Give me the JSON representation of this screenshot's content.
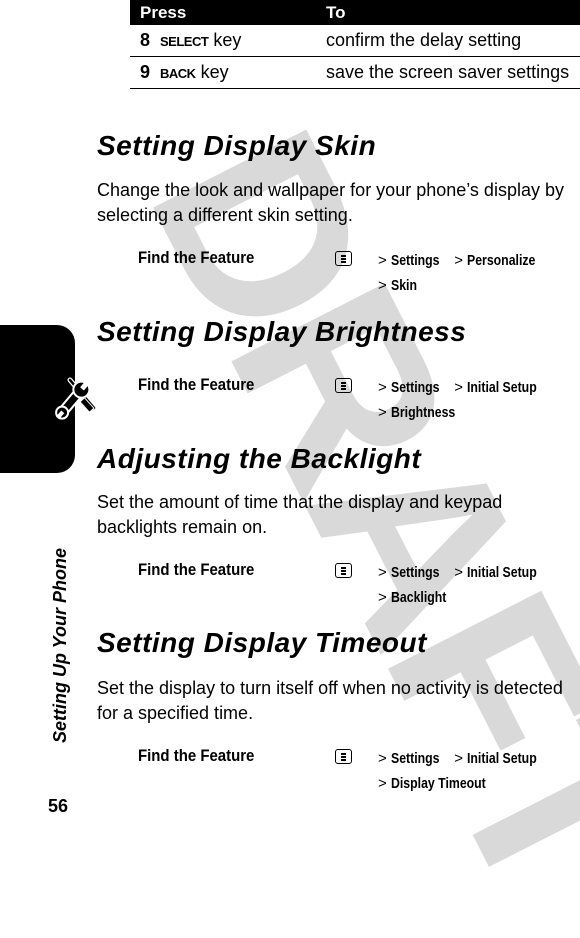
{
  "watermark": "DRAFT",
  "table": {
    "headers": [
      "Press",
      "To"
    ],
    "rows": [
      {
        "step": "8",
        "key": "SELECT",
        "key_suffix": "key",
        "action": "confirm the delay setting"
      },
      {
        "step": "9",
        "key": "BACK",
        "key_suffix": "key",
        "action": "save the screen saver settings"
      }
    ]
  },
  "sections": [
    {
      "title": "Setting Display Skin",
      "body": "Change the look and wallpaper for your phone’s display by selecting a different skin setting.",
      "feature": {
        "label": "Find the Feature",
        "icon": "menu-key-icon",
        "path1": [
          "Settings",
          "Personalize"
        ],
        "path2": "Skin"
      }
    },
    {
      "title": "Setting Display Brightness",
      "body": "",
      "feature": {
        "label": "Find the Feature",
        "icon": "menu-key-icon",
        "path1": [
          "Settings",
          "Initial Setup"
        ],
        "path2": "Brightness"
      }
    },
    {
      "title": "Adjusting the Backlight",
      "body": "Set the amount of time that the display and keypad backlights remain on.",
      "feature": {
        "label": "Find the Feature",
        "icon": "menu-key-icon",
        "path1": [
          "Settings",
          "Initial Setup"
        ],
        "path2": "Backlight"
      }
    },
    {
      "title": "Setting Display Timeout",
      "body": "Set the display to turn itself off when no activity is detected for a specified time.",
      "feature": {
        "label": "Find the Feature",
        "icon": "menu-key-icon",
        "path1": [
          "Settings",
          "Initial Setup"
        ],
        "path2": "Display Timeout"
      }
    }
  ],
  "separator": ">",
  "sidebar": {
    "chapter_title": "Setting Up Your Phone",
    "icon": "tools-icon"
  },
  "page_number": "56"
}
